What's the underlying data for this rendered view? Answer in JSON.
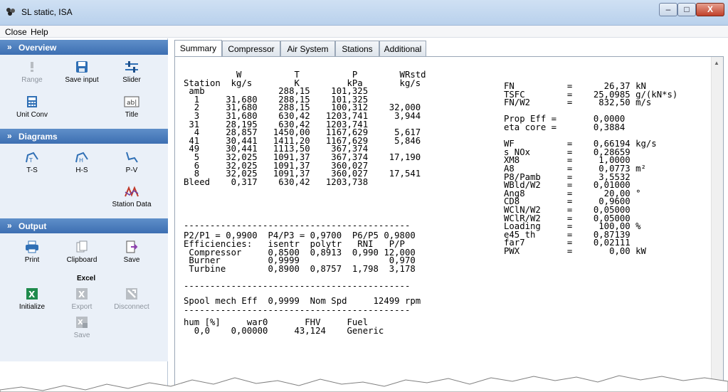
{
  "window": {
    "title": "SL static, ISA",
    "controls": {
      "minimize": "–",
      "maximize": "□",
      "close": "X"
    }
  },
  "menu": [
    "Close",
    "Help"
  ],
  "sidebar": {
    "overview": {
      "title": "Overview",
      "tools": [
        {
          "label": "Range",
          "icon": "warning-icon",
          "enabled": false
        },
        {
          "label": "Save input",
          "icon": "floppy-disk-icon",
          "enabled": true
        },
        {
          "label": "Slider",
          "icon": "slider-icon",
          "enabled": true
        },
        {
          "label": "Unit Conv",
          "icon": "calculator-icon",
          "enabled": true
        },
        {
          "label": "Title",
          "icon": "text-field-icon",
          "enabled": true
        }
      ]
    },
    "diagrams": {
      "title": "Diagrams",
      "tools": [
        {
          "label": "T-S",
          "icon": "ts-diagram-icon"
        },
        {
          "label": "H-S",
          "icon": "hs-diagram-icon"
        },
        {
          "label": "P-V",
          "icon": "pv-diagram-icon"
        },
        {
          "label": "Station Data",
          "icon": "station-data-icon"
        }
      ]
    },
    "output": {
      "title": "Output",
      "tools": [
        {
          "label": "Print",
          "icon": "printer-icon",
          "enabled": true
        },
        {
          "label": "Clipboard",
          "icon": "clipboard-icon",
          "enabled": true
        },
        {
          "label": "Save",
          "icon": "save-arrow-icon",
          "enabled": true
        }
      ],
      "excel_label": "Excel",
      "excel_tools": [
        {
          "label": "Initialize",
          "icon": "excel-icon",
          "enabled": true
        },
        {
          "label": "Export",
          "icon": "excel-export-icon",
          "enabled": false
        },
        {
          "label": "Disconnect",
          "icon": "excel-disconnect-icon",
          "enabled": false
        },
        {
          "label": "Save",
          "icon": "excel-save-icon",
          "enabled": false
        }
      ]
    }
  },
  "tabs": [
    {
      "label": "Summary",
      "active": true
    },
    {
      "label": "Compressor",
      "active": false
    },
    {
      "label": "Air System",
      "active": false
    },
    {
      "label": "Stations",
      "active": false
    },
    {
      "label": "Additional",
      "active": false
    }
  ],
  "summary": {
    "station_table": "          W          T          P        WRstd\nStation  kg/s        K         kPa       kg/s\n amb              288,15    101,325\n  1     31,680    288,15    101,325\n  2     31,680    288,15    100,312    32,000\n  3     31,680    630,42   1203,741     3,944\n 31     28,195    630,42   1203,741\n  4     28,857   1450,00   1167,629     5,617\n 41     30,441   1411,20   1167,629     5,846\n 49     30,441   1113,50    367,374\n  5     32,025   1091,37    367,374    17,190\n  6     32,025   1091,37    360,027\n  8     32,025   1091,37    360,027    17,541\nBleed    0,317    630,42   1203,738",
    "separator": "-------------------------------------------",
    "ratios": "P2/P1 = 0,9900  P4/P3 = 0,9700  P6/P5 0,9800",
    "efficiencies": "Efficiencies:   isentr  polytr   RNI   P/P\n Compressor     0,8500  0,8913  0,990 12,000\n Burner         0,9999                 0,970\n Turbine        0,8900  0,8757  1,798  3,178",
    "spool": "Spool mech Eff  0,9999  Nom Spd     12499 rpm",
    "fuel": "hum [%]     war0       FHV     Fuel\n  0,0    0,00000     43,124    Generic",
    "results": "FN          =      26,37 kN\nTSFC        =    25,0985 g/(kN*s)\nFN/W2       =     832,50 m/s\n\nProp Eff =       0,0000\neta core =       0,3884\n\nWF          =    0,66194 kg/s\ns NOx       =    0,28659\nXM8         =     1,0000\nA8          =     0,0773 m²\nP8/Pamb     =     3,5532\nWBld/W2     =    0,01000\nAng8        =      20,00 °\nCD8         =     0,9600\nWClN/W2     =    0,05000\nWClR/W2     =    0,05000\nLoading     =     100,00 %\ne45 th      =    0,87139\nfar7        =    0,02111\nPWX         =       0,00 kW"
  }
}
